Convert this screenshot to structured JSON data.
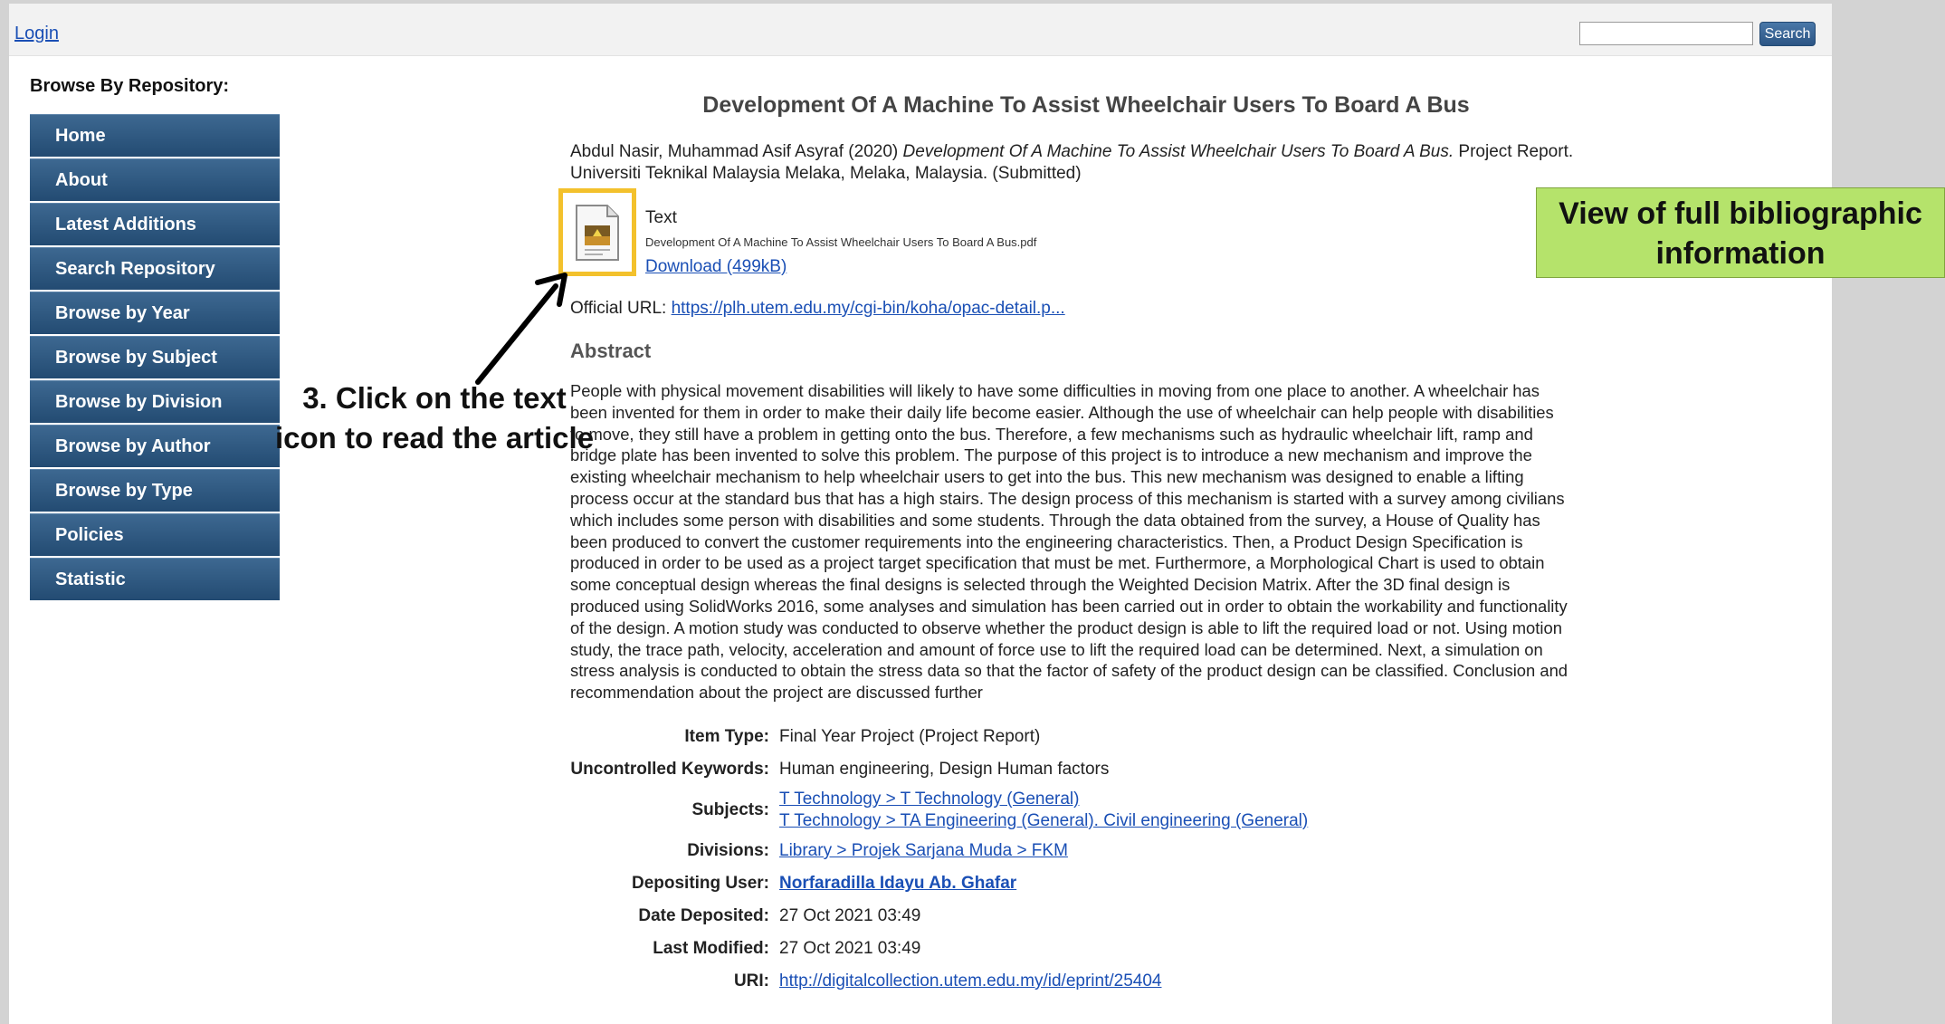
{
  "topbar": {
    "login_label": "Login",
    "search_placeholder": "",
    "search_button_label": "Search"
  },
  "sidebar": {
    "title": "Browse By Repository:",
    "items": [
      {
        "label": "Home"
      },
      {
        "label": "About"
      },
      {
        "label": "Latest Additions"
      },
      {
        "label": "Search Repository"
      },
      {
        "label": "Browse by Year"
      },
      {
        "label": "Browse by Subject"
      },
      {
        "label": "Browse by Division"
      },
      {
        "label": "Browse by Author"
      },
      {
        "label": "Browse by Type"
      },
      {
        "label": "Policies"
      },
      {
        "label": "Statistic"
      }
    ]
  },
  "article": {
    "title": "Development Of A Machine To Assist Wheelchair Users To Board A Bus",
    "citation": {
      "authors_year": "Abdul Nasir, Muhammad Asif Asyraf (2020)",
      "title_italic": "Development Of A Machine To Assist Wheelchair Users To Board A Bus.",
      "rest": "Project Report. Universiti Teknikal Malaysia Melaka, Melaka, Malaysia. (Submitted)"
    },
    "document": {
      "type": "Text",
      "filename": "Development Of A Machine To Assist Wheelchair Users To Board A Bus.pdf",
      "download_label": "Download (499kB)",
      "icon": "document-icon"
    },
    "official_url_label": "Official URL:",
    "official_url": "https://plh.utem.edu.my/cgi-bin/koha/opac-detail.p...",
    "abstract_heading": "Abstract",
    "abstract": "People with physical movement disabilities will likely to have some difficulties in moving from one place to another. A wheelchair has been invented for them in order to make their daily life become easier. Although the use of wheelchair can help people with disabilities to move, they still have a problem in getting onto the bus. Therefore, a few mechanisms such as hydraulic wheelchair lift, ramp and bridge plate has been invented to solve this problem. The purpose of this project is to introduce a new mechanism and improve the existing wheelchair mechanism to help wheelchair users to get into the bus. This new mechanism was designed to enable a lifting process occur at the standard bus that has a high stairs. The design process of this mechanism is started with a survey among civilians which includes some person with disabilities and some students. Through the data obtained from the survey, a House of Quality has been produced to convert the customer requirements into the engineering characteristics. Then, a Product Design Specification is produced in order to be used as a project target specification that must be met. Furthermore, a Morphological Chart is used to obtain some conceptual design whereas the final designs is selected through the Weighted Decision Matrix. After the 3D final design is produced using SolidWorks 2016, some analyses and simulation has been carried out in order to obtain the workability and functionality of the design. A motion study was conducted to observe whether the product design is able to lift the required load or not. Using motion study, the trace path, velocity, acceleration and amount of force use to lift the required load can be determined. Next, a simulation on stress analysis is conducted to obtain the stress data so that the factor of safety of the product design can be classified. Conclusion and recommendation about the project are discussed further"
  },
  "metadata": {
    "item_type_label": "Item Type:",
    "item_type": "Final Year Project (Project Report)",
    "keywords_label": "Uncontrolled Keywords:",
    "keywords": "Human engineering, Design Human factors",
    "subjects_label": "Subjects:",
    "subjects": [
      "T Technology > T Technology (General)",
      "T Technology > TA Engineering (General). Civil engineering (General)"
    ],
    "divisions_label": "Divisions:",
    "divisions": "Library > Projek Sarjana Muda > FKM",
    "depositing_user_label": "Depositing User:",
    "depositing_user": "Norfaradilla Idayu Ab. Ghafar",
    "date_deposited_label": "Date Deposited:",
    "date_deposited": "27 Oct 2021 03:49",
    "last_modified_label": "Last Modified:",
    "last_modified": "27 Oct 2021 03:49",
    "uri_label": "URI:",
    "uri": "http://digitalcollection.utem.edu.my/id/eprint/25404"
  },
  "annotations": {
    "callout": "View of full bibliographic information",
    "instruction": "3. Click on the text icon to read the article",
    "callout_color": "#b5e36b",
    "highlight_color": "#f3c12c"
  }
}
